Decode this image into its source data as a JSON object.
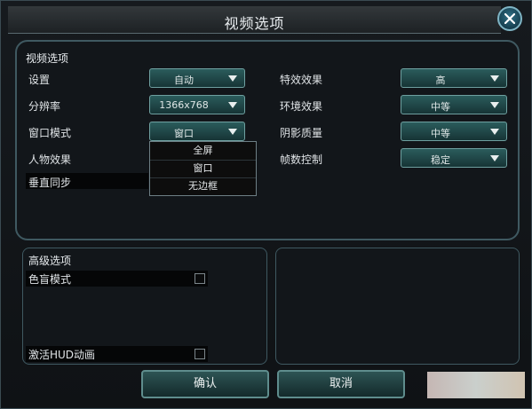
{
  "window": {
    "title": "视频选项"
  },
  "video_options": {
    "section_label": "视频选项",
    "left": [
      {
        "label": "设置",
        "value": "自动"
      },
      {
        "label": "分辨率",
        "value": "1366x768"
      },
      {
        "label": "窗口模式",
        "value": "窗口"
      },
      {
        "label": "人物效果"
      },
      {
        "label": "垂直同步"
      }
    ],
    "right": [
      {
        "label": "特效效果",
        "value": "高"
      },
      {
        "label": "环境效果",
        "value": "中等"
      },
      {
        "label": "阴影质量",
        "value": "中等"
      },
      {
        "label": "帧数控制",
        "value": "稳定"
      }
    ],
    "window_mode_options": [
      "全屏",
      "窗口",
      "无边框"
    ]
  },
  "advanced": {
    "section_label": "高级选项",
    "items": [
      {
        "label": "色盲模式",
        "checked": false
      },
      {
        "label": "激活HUD动画",
        "checked": false
      }
    ]
  },
  "buttons": {
    "confirm": "确认",
    "cancel": "取消"
  }
}
